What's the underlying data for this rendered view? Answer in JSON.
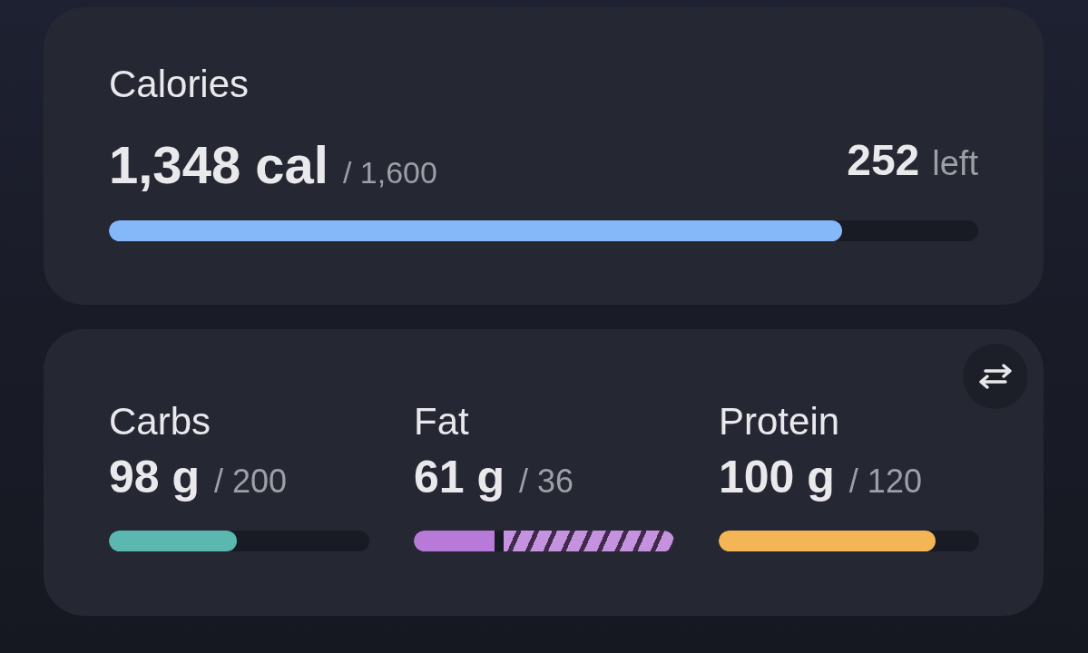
{
  "calories": {
    "label": "Calories",
    "consumed": "1,348 cal",
    "goal": "/ 1,600",
    "remaining": "252",
    "remaining_label": "left",
    "level": 0.843
  },
  "macros": [
    {
      "label": "Carbs",
      "amount": "98 g",
      "goal": "/ 200",
      "color": "#5ab8b0",
      "segments": [
        {
          "kind": "solid",
          "level": 0.49
        }
      ]
    },
    {
      "label": "Fat",
      "amount": "61 g",
      "goal": "/ 36",
      "color": "#b87ad8",
      "segments": [
        {
          "kind": "solid",
          "level": 0.31
        },
        {
          "kind": "striped",
          "level": 0.655
        }
      ]
    },
    {
      "label": "Protein",
      "amount": "100 g",
      "goal": "/ 120",
      "color": "#f3b556",
      "segments": [
        {
          "kind": "solid",
          "level": 0.833
        }
      ]
    }
  ]
}
